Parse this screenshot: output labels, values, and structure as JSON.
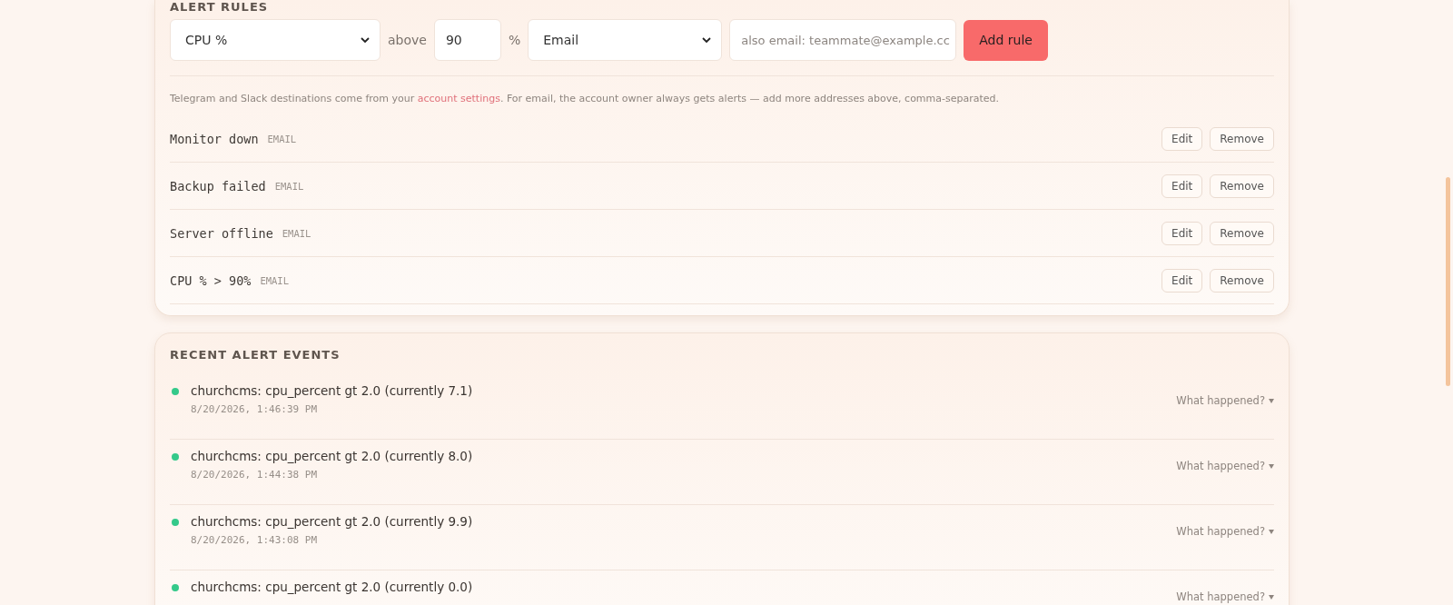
{
  "alert_rules": {
    "title": "ALERT RULES",
    "metric_select": {
      "value": "CPU %"
    },
    "above_label": "above",
    "threshold_field": {
      "value": "90"
    },
    "percent_label": "%",
    "channel_select": {
      "value": "Email"
    },
    "extra_emails_field": {
      "placeholder": "also email: teammate@example.cc"
    },
    "add_button": "Add rule",
    "note": {
      "before": "Telegram and Slack destinations come from your ",
      "link": "account settings",
      "after": ". For email, the account owner always gets alerts — add more addresses above, comma-separated."
    },
    "rules": [
      {
        "name": "Monitor down",
        "channel": "EMAIL",
        "edit": "Edit",
        "remove": "Remove"
      },
      {
        "name": "Backup failed",
        "channel": "EMAIL",
        "edit": "Edit",
        "remove": "Remove"
      },
      {
        "name": "Server offline",
        "channel": "EMAIL",
        "edit": "Edit",
        "remove": "Remove"
      },
      {
        "name": "CPU % > 90%",
        "channel": "EMAIL",
        "edit": "Edit",
        "remove": "Remove"
      }
    ]
  },
  "recent_events": {
    "title": "RECENT ALERT EVENTS",
    "events": [
      {
        "message": "churchcms: cpu_percent gt 2.0 (currently 7.1)",
        "time": "8/20/2026, 1:46:39 PM",
        "details": "What happened?",
        "color": "#34c98a"
      },
      {
        "message": "churchcms: cpu_percent gt 2.0 (currently 8.0)",
        "time": "8/20/2026, 1:44:38 PM",
        "details": "What happened?",
        "color": "#34c98a"
      },
      {
        "message": "churchcms: cpu_percent gt 2.0 (currently 9.9)",
        "time": "8/20/2026, 1:43:08 PM",
        "details": "What happened?",
        "color": "#34c98a"
      },
      {
        "message": "churchcms: cpu_percent gt 2.0 (currently 0.0)",
        "details": "What happened?",
        "color": "#34c98a"
      }
    ]
  }
}
